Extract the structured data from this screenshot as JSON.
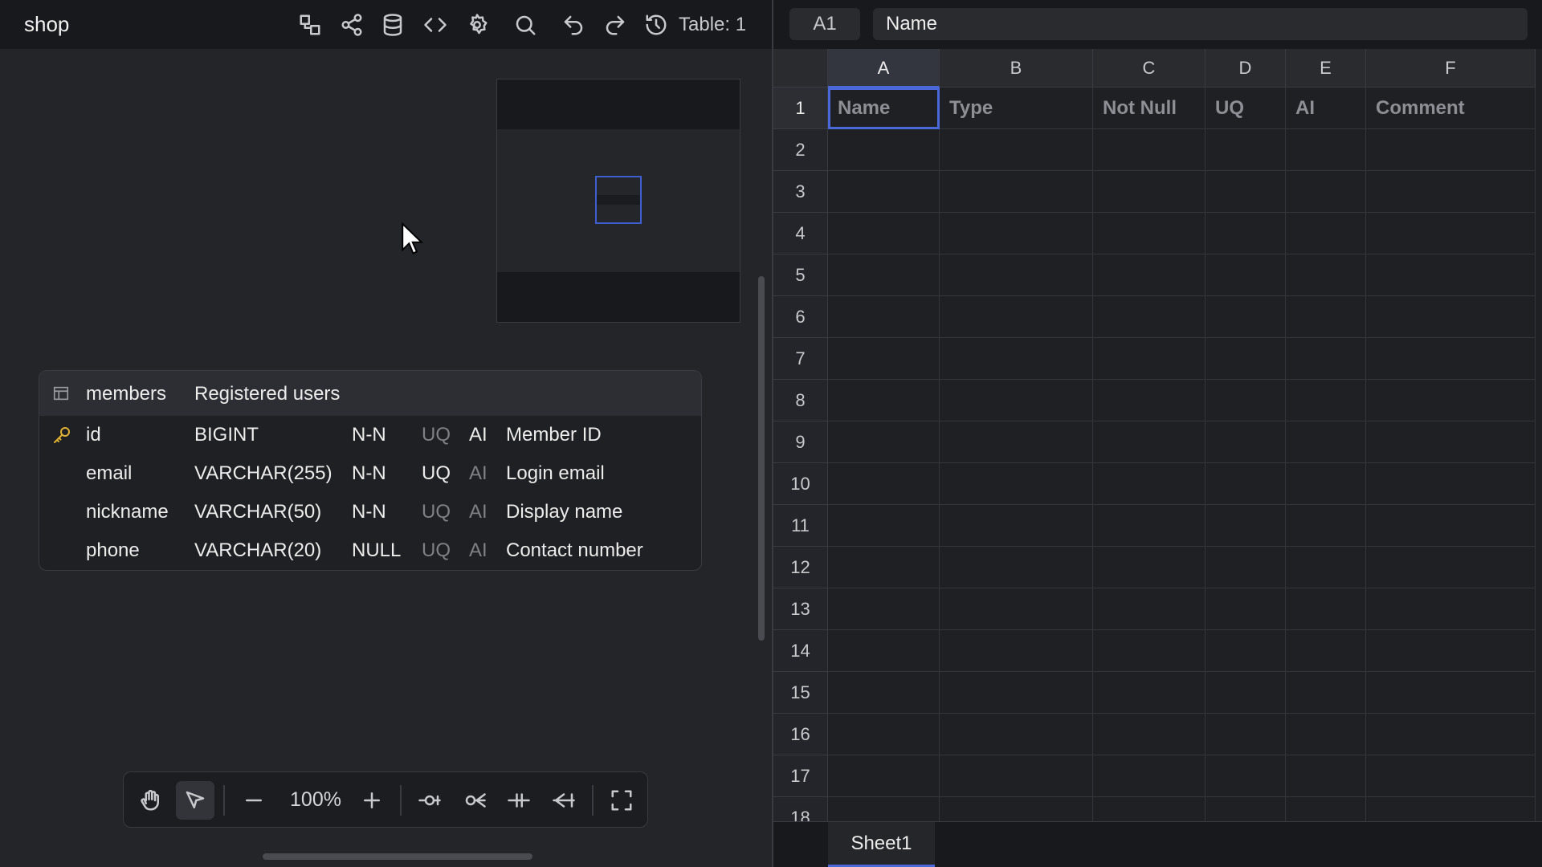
{
  "app": {
    "title": "shop",
    "table_count": "Table: 1"
  },
  "toolbar": {
    "icons": [
      "diagram-icon",
      "share-icon",
      "database-icon",
      "code-icon",
      "gear-icon",
      "search-icon",
      "undo-icon",
      "redo-icon",
      "history-icon"
    ]
  },
  "table_node": {
    "name": "members",
    "comment": "Registered users",
    "columns": [
      {
        "name": "id",
        "type": "BIGINT",
        "nullability": "N-N",
        "uq": "UQ",
        "uq_on": false,
        "ai": "AI",
        "ai_on": true,
        "comment": "Member ID",
        "primary_key": true
      },
      {
        "name": "email",
        "type": "VARCHAR(255)",
        "nullability": "N-N",
        "uq": "UQ",
        "uq_on": true,
        "ai": "AI",
        "ai_on": false,
        "comment": "Login email",
        "primary_key": false
      },
      {
        "name": "nickname",
        "type": "VARCHAR(50)",
        "nullability": "N-N",
        "uq": "UQ",
        "uq_on": false,
        "ai": "AI",
        "ai_on": false,
        "comment": "Display name",
        "primary_key": false
      },
      {
        "name": "phone",
        "type": "VARCHAR(20)",
        "nullability": "NULL",
        "uq": "UQ",
        "uq_on": false,
        "ai": "AI",
        "ai_on": false,
        "comment": "Contact number",
        "primary_key": false
      }
    ]
  },
  "bottom_toolbar": {
    "zoom": "100%"
  },
  "spreadsheet": {
    "cell_ref": "A1",
    "formula_value": "Name",
    "columns": [
      "A",
      "B",
      "C",
      "D",
      "E",
      "F"
    ],
    "row_numbers": [
      "1",
      "2",
      "3",
      "4",
      "5",
      "6",
      "7",
      "8",
      "9",
      "10",
      "11",
      "12",
      "13",
      "14",
      "15",
      "16",
      "17",
      "18"
    ],
    "header_row": [
      "Name",
      "Type",
      "Not Null",
      "UQ",
      "AI",
      "Comment"
    ],
    "sheet_tab": "Sheet1"
  },
  "colors": {
    "accent": "#4a68d8",
    "key": "#e0b133",
    "background": "#242529"
  }
}
